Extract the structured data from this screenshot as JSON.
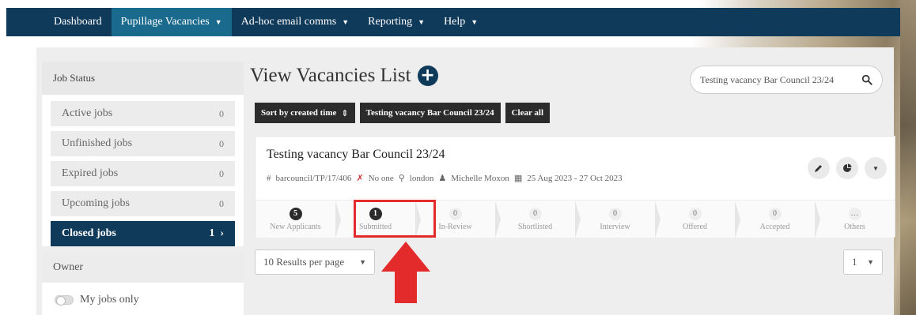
{
  "nav": {
    "items": [
      {
        "label": "Dashboard",
        "caret": false,
        "active": false
      },
      {
        "label": "Pupillage Vacancies",
        "caret": true,
        "active": true
      },
      {
        "label": "Ad-hoc email comms",
        "caret": true,
        "active": false
      },
      {
        "label": "Reporting",
        "caret": true,
        "active": false
      },
      {
        "label": "Help",
        "caret": true,
        "active": false
      }
    ]
  },
  "sidebar": {
    "header": "Job Status",
    "items": [
      {
        "label": "Active jobs",
        "count": "0",
        "active": false
      },
      {
        "label": "Unfinished jobs",
        "count": "0",
        "active": false
      },
      {
        "label": "Expired jobs",
        "count": "0",
        "active": false
      },
      {
        "label": "Upcoming jobs",
        "count": "0",
        "active": false
      },
      {
        "label": "Closed jobs",
        "count": "1",
        "active": true
      }
    ],
    "owner_header": "Owner",
    "owner_toggle_label": "My jobs only"
  },
  "main": {
    "title": "View Vacancies List",
    "search_value": "Testing vacancy Bar Council 23/24",
    "filters": {
      "sort_label": "Sort by created time",
      "active_filter": "Testing vacancy Bar Council 23/24",
      "clear_label": "Clear all"
    },
    "job": {
      "title": "Testing vacancy Bar Council 23/24",
      "reference": "barcouncil/TP/17/406",
      "visibility": "No one",
      "location": "london",
      "owner": "Michelle Moxon",
      "dates": "25 Aug 2023 - 27 Oct 2023"
    },
    "stages": [
      {
        "name": "New Applicants",
        "count": "5",
        "filled": true
      },
      {
        "name": "Submitted",
        "count": "1",
        "filled": true
      },
      {
        "name": "In-Review",
        "count": "0",
        "filled": false
      },
      {
        "name": "Shortlisted",
        "count": "0",
        "filled": false
      },
      {
        "name": "Interview",
        "count": "0",
        "filled": false
      },
      {
        "name": "Offered",
        "count": "0",
        "filled": false
      },
      {
        "name": "Accepted",
        "count": "0",
        "filled": false
      },
      {
        "name": "Others",
        "count": "…",
        "filled": false
      }
    ],
    "per_page": "10 Results per page",
    "page": "1"
  },
  "colors": {
    "nav_bg": "#0f3a5a",
    "nav_active": "#1a6a8e",
    "highlight": "#e32b2b"
  }
}
